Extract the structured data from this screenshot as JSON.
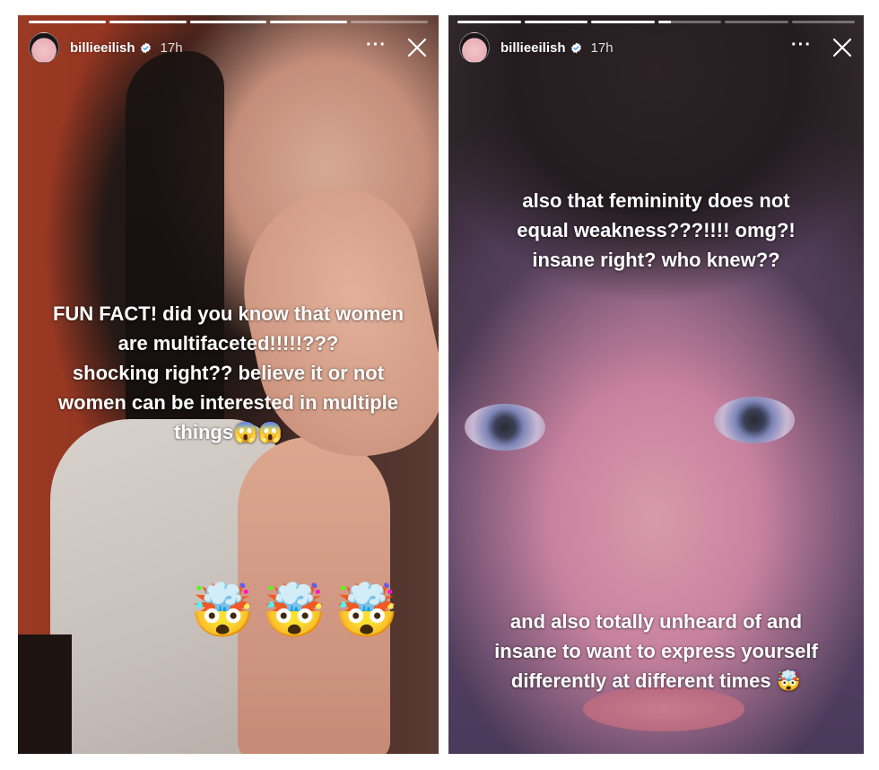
{
  "stories": [
    {
      "progress": [
        1,
        1,
        1,
        1,
        0.0
      ],
      "username": "billieeilish",
      "verified_icon": "verified-badge-icon",
      "time_ago": "17h",
      "more_label": "···",
      "caption": "FUN FACT! did you know that women\nare multifaceted!!!!!???\nshocking right?? believe it or not\nwomen can be interested in multiple\nthings😱😱",
      "stickers": [
        "🤯",
        "🤯",
        "🤯"
      ]
    },
    {
      "progress": [
        1,
        1,
        1,
        0.2,
        0,
        0
      ],
      "username": "billieeilish",
      "verified_icon": "verified-badge-icon",
      "time_ago": "17h",
      "more_label": "···",
      "caption_top": "also that femininity does not\nequal weakness???!!!! omg?!\ninsane right? who knew??",
      "caption_bottom": "and also totally unheard of and\ninsane to want to express yourself\ndifferently at different times 🤯"
    }
  ],
  "colors": {
    "text": "#ffffff",
    "background": "#ffffff",
    "verified_blue": "#3897f0"
  }
}
